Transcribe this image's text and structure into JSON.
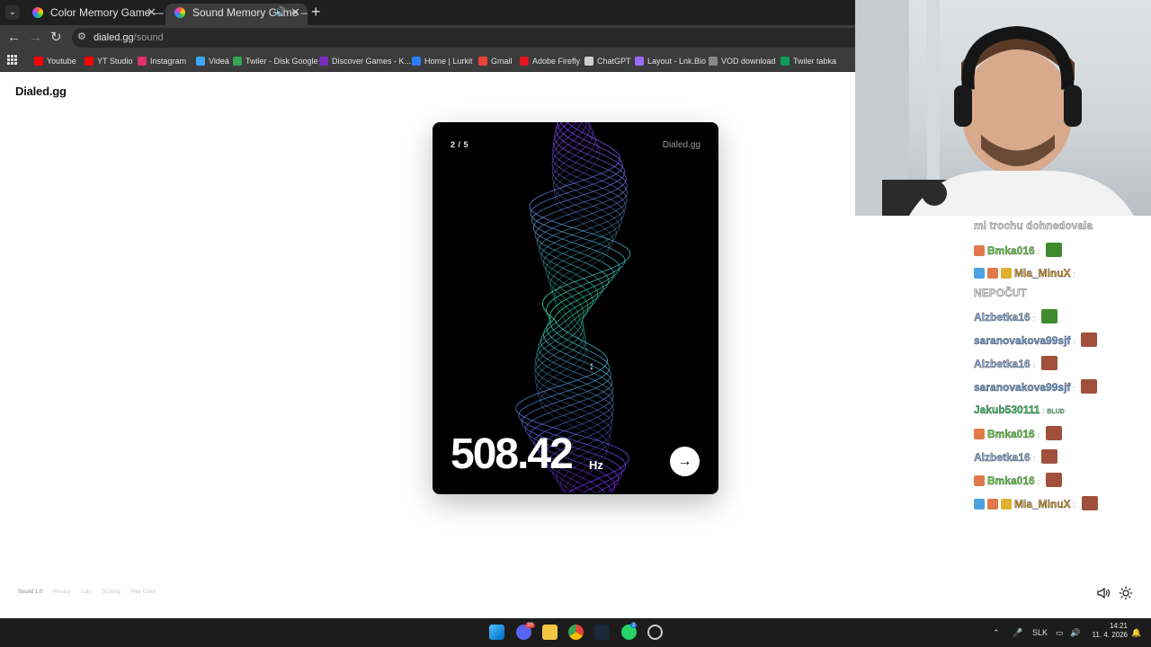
{
  "browser": {
    "tabs": [
      {
        "title": "Color Memory Game — How W",
        "active": false,
        "close": "✕"
      },
      {
        "title": "Sound Memory Game — H",
        "active": true,
        "close": "✕"
      }
    ],
    "new_tab": "+",
    "tab_menu": "⌄",
    "url_host": "dialed.gg",
    "url_path": "/sound",
    "bookmarks": [
      {
        "label": "Youtube",
        "color": "#ff0000"
      },
      {
        "label": "YT Studio",
        "color": "#ff0000"
      },
      {
        "label": "Instagram",
        "color": "#e1306c"
      },
      {
        "label": "Videá",
        "color": "#3ea6ff"
      },
      {
        "label": "Twiler - Disk Google",
        "color": "#34a853"
      },
      {
        "label": "Discover Games - K...",
        "color": "#7b2cbf"
      },
      {
        "label": "Home | Lurkit",
        "color": "#2b7fff"
      },
      {
        "label": "Gmail",
        "color": "#ea4335"
      },
      {
        "label": "Adobe Firefly",
        "color": "#e8131e"
      },
      {
        "label": "ChatGPT",
        "color": "#d0d0d0"
      },
      {
        "label": "Layout - Lnk.Bio",
        "color": "#9b6bff"
      },
      {
        "label": "VOD download",
        "color": "#888888"
      },
      {
        "label": "Twiler tabka",
        "color": "#0f9d58"
      }
    ]
  },
  "page": {
    "brand": "Dialed.gg",
    "card": {
      "round": "2 / 5",
      "brand": "Dialed.gg",
      "frequency": "508.42",
      "unit": "Hz",
      "next_arrow": "→",
      "cursor": "↕"
    },
    "footer": {
      "version": "Sound 1.0",
      "links": [
        "Privacy",
        "Lulo",
        "Scoring",
        "Play Color"
      ]
    }
  },
  "chat": [
    {
      "user": "",
      "user_color": "#dcdcdc",
      "message": "mi trochu dohnedovala",
      "badges": [],
      "emote": false
    },
    {
      "user": "Bmka016",
      "user_color": "#6de04a",
      "message": "",
      "badges": [
        "#e07a4a"
      ],
      "emote": true
    },
    {
      "user": "Mia_MinuX",
      "user_color": "#e0a030",
      "message": "NEPOČUT",
      "badges": [
        "#4aa3e0",
        "#e07a4a",
        "#e0b030"
      ],
      "emote": false
    },
    {
      "user": "Alzbetka16",
      "user_color": "#8fb4e8",
      "message": "",
      "badges": [],
      "emote": true
    },
    {
      "user": "saranovakova99sjf",
      "user_color": "#6f9fe0",
      "message": "",
      "badges": [],
      "emote": true
    },
    {
      "user": "Alzbetka16",
      "user_color": "#8fb4e8",
      "message": "",
      "badges": [],
      "emote": true
    },
    {
      "user": "saranovakova99sjf",
      "user_color": "#6f9fe0",
      "message": "",
      "badges": [],
      "emote": true
    },
    {
      "user": "Jakub530111",
      "user_color": "#38d46a",
      "message": "BLUD",
      "badges": [],
      "emote": false
    },
    {
      "user": "Bmka016",
      "user_color": "#6de04a",
      "message": "",
      "badges": [
        "#e07a4a"
      ],
      "emote": true
    },
    {
      "user": "Alzbetka16",
      "user_color": "#8fb4e8",
      "message": "",
      "badges": [],
      "emote": true
    },
    {
      "user": "Bmka016",
      "user_color": "#6de04a",
      "message": "",
      "badges": [
        "#e07a4a"
      ],
      "emote": true
    },
    {
      "user": "Mia_MinuX",
      "user_color": "#e0a030",
      "message": "",
      "badges": [
        "#4aa3e0",
        "#e07a4a",
        "#e0b030"
      ],
      "emote": true
    }
  ],
  "taskbar": {
    "tray_lang": "SLK",
    "time": "14:21",
    "date": "11. 4. 2026",
    "discord_badge": "20",
    "whatsapp_badge": "2"
  }
}
